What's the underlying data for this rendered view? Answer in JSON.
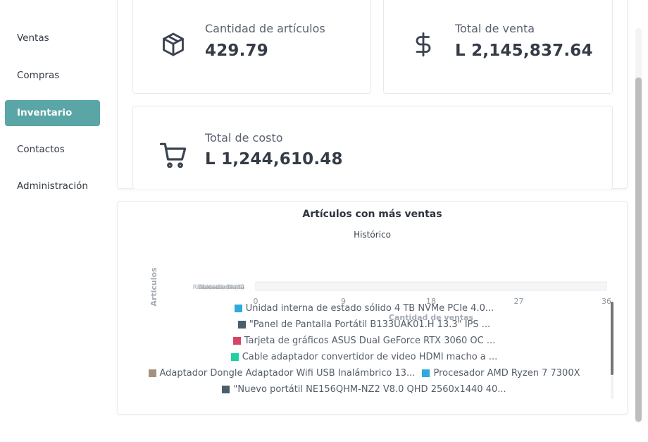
{
  "sidebar": {
    "items": [
      {
        "label": "Ventas",
        "active": false
      },
      {
        "label": "Compras",
        "active": false
      },
      {
        "label": "Inventario",
        "active": true
      },
      {
        "label": "Contactos",
        "active": false
      },
      {
        "label": "Administración",
        "active": false
      }
    ]
  },
  "stats": {
    "quantity": {
      "label": "Cantidad de artículos",
      "value": "429.79",
      "icon": "box-icon"
    },
    "sales": {
      "label": "Total de venta",
      "value": "L 2,145,837.64",
      "icon": "dollar-icon"
    },
    "cost": {
      "label": "Total de costo",
      "value": "L 1,244,610.48",
      "icon": "cart-icon"
    }
  },
  "chart_data": {
    "type": "bar",
    "title": "Artículos con más ventas",
    "subtitle": "Histórico",
    "xlabel": "Cantidad de ventas",
    "ylabel": "Articulos",
    "xlim": [
      0,
      36
    ],
    "xticks": [
      "0",
      "9",
      "18",
      "27",
      "36"
    ],
    "orientation": "horizontal",
    "series": [
      {
        "name": "Unidad interna de estado sólido 4 TB NVMe PCIe 4.0...",
        "color": "#2eaadc"
      },
      {
        "name": "\"Panel de Pantalla Portátil B133UAK01.H 13.3\" IPS ...",
        "color": "#4d5e6b"
      },
      {
        "name": "Tarjeta de gráficos ASUS Dual GeForce RTX 3060 OC ...",
        "color": "#d64565"
      },
      {
        "name": "Cable adaptador convertidor de video HDMI macho a ...",
        "color": "#1fd1a1"
      },
      {
        "name": "Adaptador Dongle Adaptador Wifi USB Inalámbrico 13...",
        "color": "#a39282"
      },
      {
        "name": "Procesador AMD Ryzen 7 7300X",
        "color": "#2eaadc"
      },
      {
        "name": "\"Nuevo portátil NE156QHM-NZ2 V8.0 QHD 2560x1440 40...",
        "color": "#4d5e6b"
      }
    ]
  }
}
